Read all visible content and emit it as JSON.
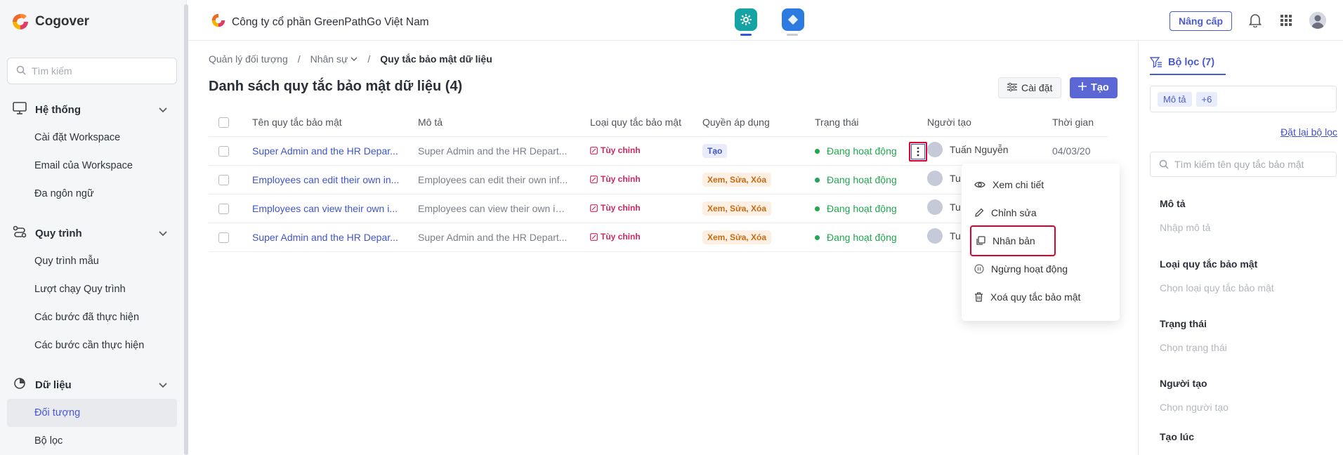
{
  "sidebar": {
    "brand": "Cogover",
    "search_placeholder": "Tìm kiếm",
    "sections": [
      {
        "title": "Hệ thống",
        "items": [
          "Cài đặt Workspace",
          "Email của Workspace",
          "Đa ngôn ngữ"
        ]
      },
      {
        "title": "Quy trình",
        "items": [
          "Quy trình mẫu",
          "Lượt chạy Quy trình",
          "Các bước đã thực hiện",
          "Các bước cần thực hiện"
        ]
      },
      {
        "title": "Dữ liệu",
        "items": [
          "Đối tượng",
          "Bộ lọc"
        ]
      }
    ],
    "active_item": "Đối tượng"
  },
  "topbar": {
    "company": "Công ty cổ phần GreenPathGo Việt Nam",
    "upgrade_label": "Nâng cấp",
    "icons": [
      "settings-app-icon",
      "secondary-app-icon",
      "bell-icon",
      "apps-grid-icon",
      "user-avatar"
    ]
  },
  "breadcrumb": [
    "Quản lý đối tượng",
    "Nhân sự",
    "Quy tắc bảo mật dữ liệu"
  ],
  "page": {
    "title": "Danh sách quy tắc bảo mật dữ liệu (4)",
    "settings_label": "Cài đặt",
    "create_label": "Tạo"
  },
  "table": {
    "headers": [
      "Tên quy tắc bảo mật",
      "Mô tả",
      "Loại quy tắc bảo mật",
      "Quyền áp dụng",
      "Trạng thái",
      "Người tạo",
      "Thời gian"
    ],
    "rows": [
      {
        "name": "Super Admin and the HR Depar...",
        "desc": "Super Admin and the HR Depart...",
        "type": "Tùy chỉnh",
        "perm": "Tạo",
        "status": "Đang hoạt động",
        "creator": "Tuấn Nguyễn",
        "time": "04/03/20"
      },
      {
        "name": "Employees can edit their own in...",
        "desc": "Employees can edit their own inf...",
        "type": "Tùy chỉnh",
        "perm": "Xem, Sửa, Xóa",
        "status": "Đang hoạt động",
        "creator": "Tu",
        "time": ""
      },
      {
        "name": "Employees can view their own i...",
        "desc": "Employees can view their own inf...",
        "type": "Tùy chỉnh",
        "perm": "Xem, Sửa, Xóa",
        "status": "Đang hoạt động",
        "creator": "Tu",
        "time": ""
      },
      {
        "name": "Super Admin and the HR Depar...",
        "desc": "Super Admin and the HR Depart...",
        "type": "Tùy chỉnh",
        "perm": "Xem, Sửa, Xóa",
        "status": "Đang hoạt động",
        "creator": "Tu",
        "time": ""
      }
    ]
  },
  "row_menu": {
    "items": [
      "Xem chi tiết",
      "Chỉnh sửa",
      "Nhân bản",
      "Ngừng hoạt động",
      "Xoá quy tắc bảo mật"
    ]
  },
  "filter": {
    "tab_label": "Bộ lọc (7)",
    "tags": [
      "Mô tả",
      "+6"
    ],
    "reset_label": "Đặt lại bộ lọc",
    "search_placeholder": "Tìm kiếm tên quy tắc bảo mật",
    "fields": [
      {
        "label": "Mô tả",
        "placeholder": "Nhập mô tả"
      },
      {
        "label": "Loại quy tắc bảo mật",
        "placeholder": "Chọn loại quy tắc bảo mật"
      },
      {
        "label": "Trạng thái",
        "placeholder": "Chọn trạng thái"
      },
      {
        "label": "Người tạo",
        "placeholder": "Chọn người tạo"
      },
      {
        "label": "Tạo lúc",
        "placeholder": ""
      }
    ]
  },
  "colors": {
    "accent": "#4a5ad1",
    "create_button": "#5c67d6",
    "status_active": "#22a64f",
    "type_tag": "#d0275b",
    "highlight_box": "#e0002b"
  }
}
